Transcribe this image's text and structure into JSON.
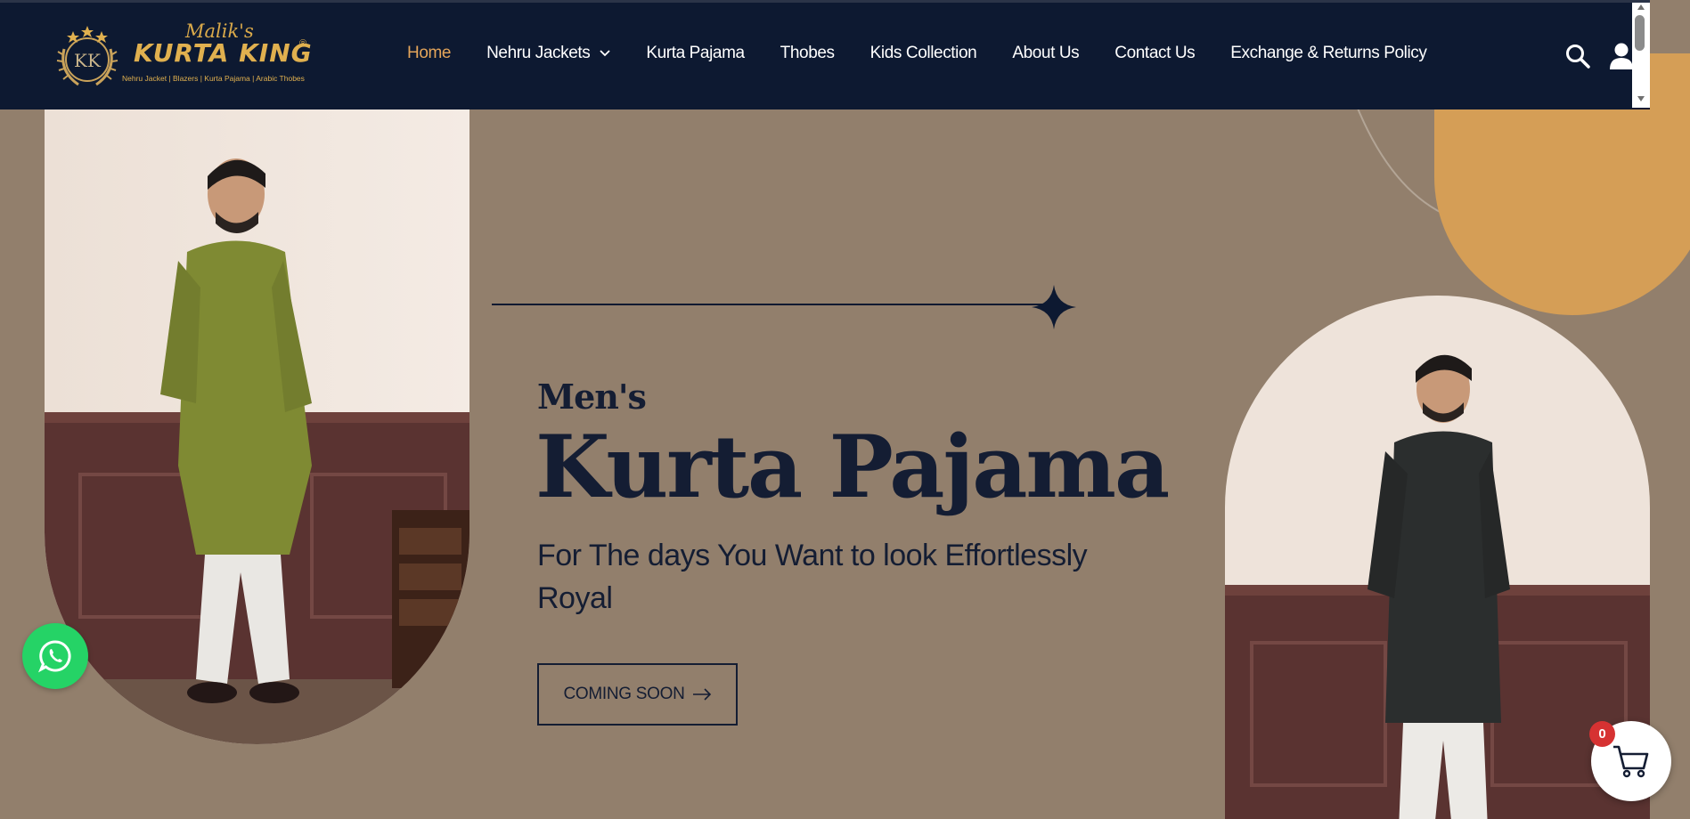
{
  "logo": {
    "top_text": "Malik's",
    "name": "KURTA KING",
    "reg_mark": "®",
    "tagline": "Nehru Jacket | Blazers | Kurta Pajama | Arabic Thobes",
    "emblem_text": "KK"
  },
  "nav": {
    "items": [
      {
        "label": "Home",
        "active": true
      },
      {
        "label": "Nehru Jackets",
        "has_dropdown": true
      },
      {
        "label": "Kurta Pajama"
      },
      {
        "label": "Thobes"
      },
      {
        "label": "Kids Collection"
      },
      {
        "label": "About Us"
      },
      {
        "label": "Contact Us"
      },
      {
        "label": "Exchange & Returns Policy"
      }
    ]
  },
  "header_icons": [
    "search-icon",
    "user-icon"
  ],
  "hero": {
    "small_heading": "Men's",
    "title": "Kurta Pajama",
    "subtitle": "For The days You Want to look Effortlessly Royal",
    "button_label": "COMING SOON"
  },
  "cart": {
    "count": "0"
  },
  "colors": {
    "header_bg": "#0d1931",
    "hero_bg": "#927f6c",
    "accent_orange": "#d59e56",
    "nav_active": "#e4a55a",
    "logo_gold": "#e0b04f",
    "whatsapp_green": "#25d366",
    "badge_red": "#d63232"
  }
}
